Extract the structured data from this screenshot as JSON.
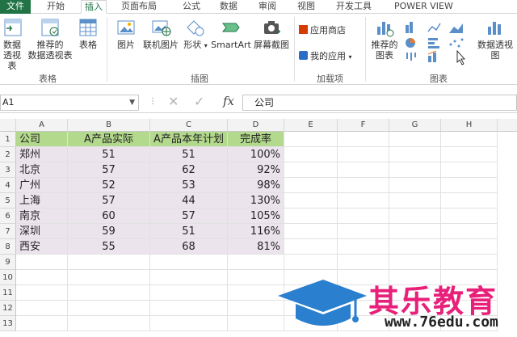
{
  "tabs": [
    "文件",
    "开始",
    "插入",
    "页面布局",
    "公式",
    "数据",
    "审阅",
    "视图",
    "开发工具",
    "POWER VIEW"
  ],
  "ribbon": {
    "tables": {
      "pivot": "数据\n透视表",
      "rec_pivot": "推荐的\n数据透视表",
      "table": "表格",
      "group": "表格"
    },
    "illus": {
      "picture": "图片",
      "online": "联机图片",
      "shapes": "形状",
      "smartart": "SmartArt",
      "screenshot": "屏幕截图",
      "group": "插图"
    },
    "addins": {
      "store": "应用商店",
      "myapps": "我的应用",
      "group": "加载项"
    },
    "charts": {
      "recommended": "推荐的\n图表",
      "pivotchart": "数据透视图",
      "group": "图表"
    }
  },
  "formula_bar": {
    "namebox": "A1",
    "value": "公司"
  },
  "columns": [
    "A",
    "B",
    "C",
    "D",
    "E",
    "F",
    "G",
    "H"
  ],
  "rows": [
    "1",
    "2",
    "3",
    "4",
    "5",
    "6",
    "7",
    "8",
    "9",
    "10",
    "11",
    "12",
    "13"
  ],
  "table": {
    "headers": [
      "公司",
      "A产品实际",
      "A产品本年计划",
      "完成率"
    ],
    "rows": [
      [
        "郑州",
        "51",
        "51",
        "100%"
      ],
      [
        "北京",
        "57",
        "62",
        "92%"
      ],
      [
        "广州",
        "52",
        "53",
        "98%"
      ],
      [
        "上海",
        "57",
        "44",
        "130%"
      ],
      [
        "南京",
        "60",
        "57",
        "105%"
      ],
      [
        "深圳",
        "59",
        "51",
        "116%"
      ],
      [
        "西安",
        "55",
        "68",
        "81%"
      ]
    ]
  },
  "watermark": {
    "name": "其乐教育",
    "url": "www.76edu.com"
  },
  "colors": {
    "accent": "#217346",
    "header_fill": "#b3d98c",
    "body_fill": "#ece4ed",
    "brand": "#e8207a",
    "cap": "#2a7fcf"
  }
}
